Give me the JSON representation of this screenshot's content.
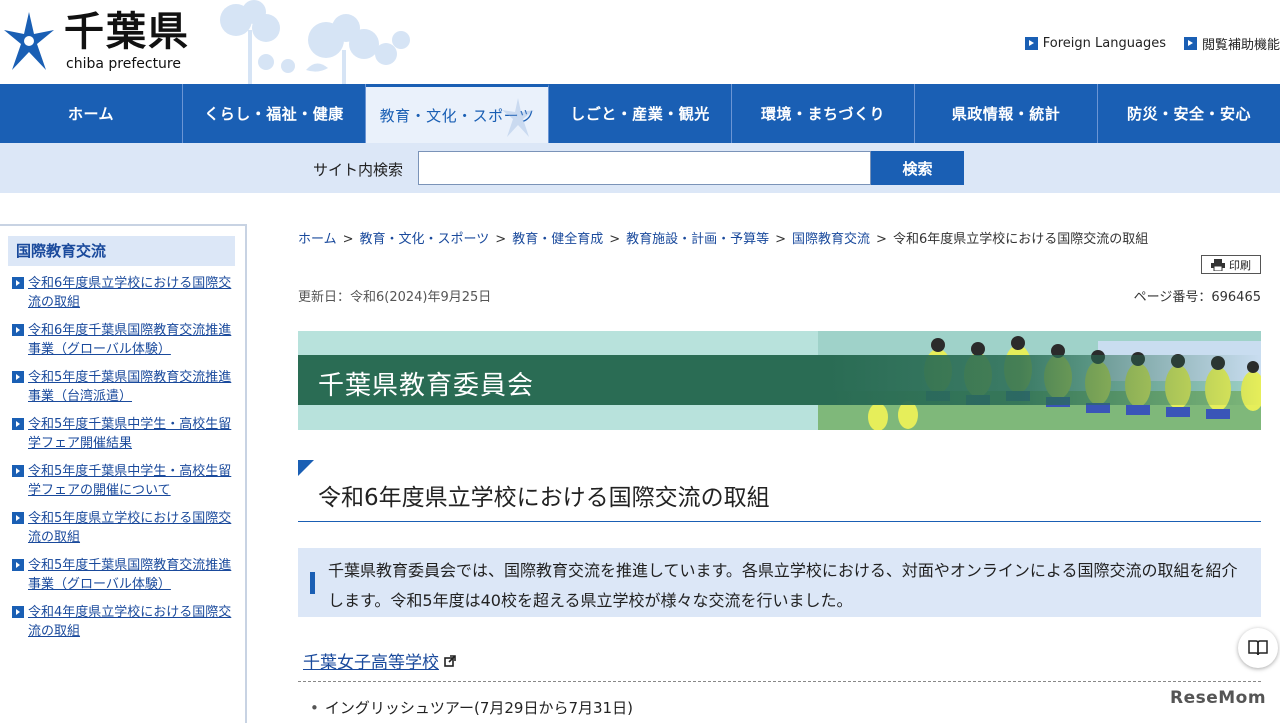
{
  "header": {
    "logo_kanji": "千葉県",
    "logo_en": "chiba prefecture",
    "util_links": [
      {
        "label": "Foreign Languages"
      },
      {
        "label": "閲覧補助機能"
      }
    ]
  },
  "gnav": [
    {
      "label": "ホーム"
    },
    {
      "label": "くらし・福祉・健康"
    },
    {
      "label": "教育・文化・スポーツ"
    },
    {
      "label": "しごと・産業・観光"
    },
    {
      "label": "環境・まちづくり"
    },
    {
      "label": "県政情報・統計"
    },
    {
      "label": "防災・安全・安心"
    }
  ],
  "search": {
    "label": "サイト内検索",
    "value": "",
    "button": "検索"
  },
  "sidebar": {
    "title": "国際教育交流",
    "items": [
      {
        "label": "令和6年度県立学校における国際交流の取組"
      },
      {
        "label": "令和6年度千葉県国際教育交流推進事業（グローバル体験）"
      },
      {
        "label": "令和5年度千葉県国際教育交流推進事業（台湾派遣）"
      },
      {
        "label": "令和5年度千葉県中学生・高校生留学フェア開催結果"
      },
      {
        "label": "令和5年度千葉県中学生・高校生留学フェアの開催について"
      },
      {
        "label": "令和5年度県立学校における国際交流の取組"
      },
      {
        "label": "令和5年度千葉県国際教育交流推進事業（グローバル体験）"
      },
      {
        "label": "令和4年度県立学校における国際交流の取組"
      }
    ]
  },
  "breadcrumb": [
    {
      "label": "ホーム",
      "link": true
    },
    {
      "label": "教育・文化・スポーツ",
      "link": true
    },
    {
      "label": "教育・健全育成",
      "link": true
    },
    {
      "label": "教育施設・計画・予算等",
      "link": true
    },
    {
      "label": "国際教育交流",
      "link": true
    },
    {
      "label": "令和6年度県立学校における国際交流の取組",
      "link": false
    }
  ],
  "breadcrumb_sep": ">",
  "print_label": "印刷",
  "updated": "更新日：令和6(2024)年9月25日",
  "page_number": "ページ番号：696465",
  "banner_title": "千葉県教育委員会",
  "page_title": "令和6年度県立学校における国際交流の取組",
  "lead": "千葉県教育委員会では、国際教育交流を推進しています。各県立学校における、対面やオンラインによる国際交流の取組を紹介します。令和5年度は40校を超える県立学校が様々な交流を行いました。",
  "section": {
    "heading": "千葉女子高等学校",
    "items": [
      "イングリッシュツアー(7月29日から7月31日)"
    ]
  },
  "watermark": "ReseMom",
  "colors": {
    "nav_blue": "#1a5fb4",
    "light_blue": "#dce7f7",
    "banner_green": "#2a6c54"
  }
}
